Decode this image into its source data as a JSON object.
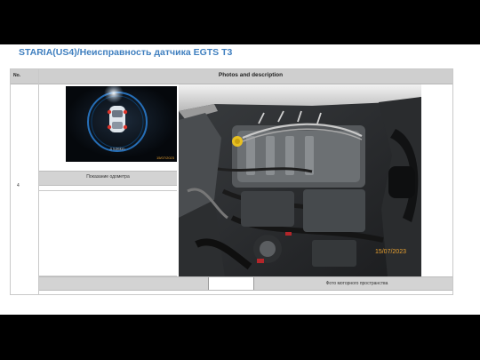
{
  "slide": {
    "title": "STARIA(US4)/Неисправность датчика EGTS T3"
  },
  "table": {
    "header_no": "No.",
    "header_photos": "Photos and description",
    "row_number": "4"
  },
  "photos": {
    "odometer": {
      "caption": "Показание одометра",
      "date_stamp": "15/07/2023",
      "readout": "4 536km"
    },
    "engine_bay": {
      "caption": "Фото моторного пространства",
      "date_stamp": "15/07/2023"
    }
  },
  "colors": {
    "title": "#3f7fbf",
    "header_bg": "#cfcfcf",
    "caption_bg": "#d3d3d3",
    "date_stamp": "#e8a030"
  }
}
